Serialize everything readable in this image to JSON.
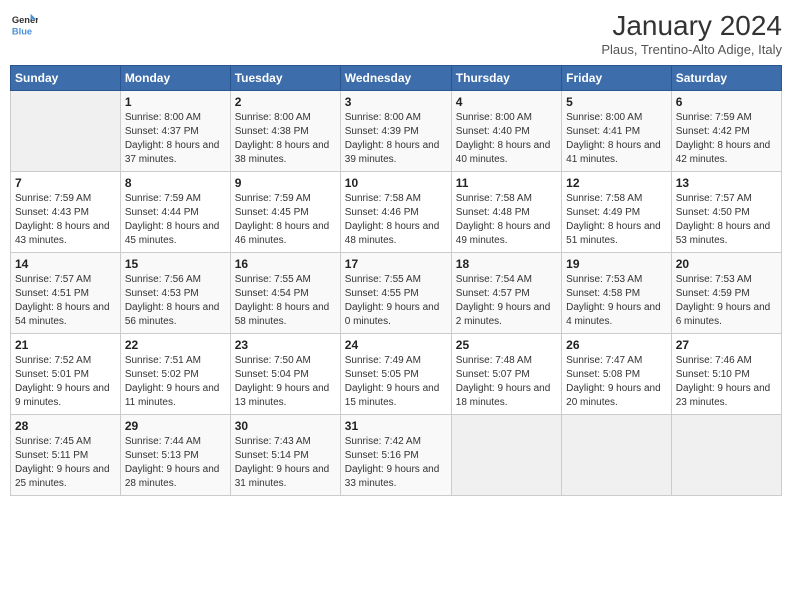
{
  "header": {
    "logo_text_general": "General",
    "logo_text_blue": "Blue",
    "title": "January 2024",
    "subtitle": "Plaus, Trentino-Alto Adige, Italy"
  },
  "weekdays": [
    "Sunday",
    "Monday",
    "Tuesday",
    "Wednesday",
    "Thursday",
    "Friday",
    "Saturday"
  ],
  "weeks": [
    [
      {
        "day": "",
        "sunrise": "",
        "sunset": "",
        "daylight": ""
      },
      {
        "day": "1",
        "sunrise": "Sunrise: 8:00 AM",
        "sunset": "Sunset: 4:37 PM",
        "daylight": "Daylight: 8 hours and 37 minutes."
      },
      {
        "day": "2",
        "sunrise": "Sunrise: 8:00 AM",
        "sunset": "Sunset: 4:38 PM",
        "daylight": "Daylight: 8 hours and 38 minutes."
      },
      {
        "day": "3",
        "sunrise": "Sunrise: 8:00 AM",
        "sunset": "Sunset: 4:39 PM",
        "daylight": "Daylight: 8 hours and 39 minutes."
      },
      {
        "day": "4",
        "sunrise": "Sunrise: 8:00 AM",
        "sunset": "Sunset: 4:40 PM",
        "daylight": "Daylight: 8 hours and 40 minutes."
      },
      {
        "day": "5",
        "sunrise": "Sunrise: 8:00 AM",
        "sunset": "Sunset: 4:41 PM",
        "daylight": "Daylight: 8 hours and 41 minutes."
      },
      {
        "day": "6",
        "sunrise": "Sunrise: 7:59 AM",
        "sunset": "Sunset: 4:42 PM",
        "daylight": "Daylight: 8 hours and 42 minutes."
      }
    ],
    [
      {
        "day": "7",
        "sunrise": "Sunrise: 7:59 AM",
        "sunset": "Sunset: 4:43 PM",
        "daylight": "Daylight: 8 hours and 43 minutes."
      },
      {
        "day": "8",
        "sunrise": "Sunrise: 7:59 AM",
        "sunset": "Sunset: 4:44 PM",
        "daylight": "Daylight: 8 hours and 45 minutes."
      },
      {
        "day": "9",
        "sunrise": "Sunrise: 7:59 AM",
        "sunset": "Sunset: 4:45 PM",
        "daylight": "Daylight: 8 hours and 46 minutes."
      },
      {
        "day": "10",
        "sunrise": "Sunrise: 7:58 AM",
        "sunset": "Sunset: 4:46 PM",
        "daylight": "Daylight: 8 hours and 48 minutes."
      },
      {
        "day": "11",
        "sunrise": "Sunrise: 7:58 AM",
        "sunset": "Sunset: 4:48 PM",
        "daylight": "Daylight: 8 hours and 49 minutes."
      },
      {
        "day": "12",
        "sunrise": "Sunrise: 7:58 AM",
        "sunset": "Sunset: 4:49 PM",
        "daylight": "Daylight: 8 hours and 51 minutes."
      },
      {
        "day": "13",
        "sunrise": "Sunrise: 7:57 AM",
        "sunset": "Sunset: 4:50 PM",
        "daylight": "Daylight: 8 hours and 53 minutes."
      }
    ],
    [
      {
        "day": "14",
        "sunrise": "Sunrise: 7:57 AM",
        "sunset": "Sunset: 4:51 PM",
        "daylight": "Daylight: 8 hours and 54 minutes."
      },
      {
        "day": "15",
        "sunrise": "Sunrise: 7:56 AM",
        "sunset": "Sunset: 4:53 PM",
        "daylight": "Daylight: 8 hours and 56 minutes."
      },
      {
        "day": "16",
        "sunrise": "Sunrise: 7:55 AM",
        "sunset": "Sunset: 4:54 PM",
        "daylight": "Daylight: 8 hours and 58 minutes."
      },
      {
        "day": "17",
        "sunrise": "Sunrise: 7:55 AM",
        "sunset": "Sunset: 4:55 PM",
        "daylight": "Daylight: 9 hours and 0 minutes."
      },
      {
        "day": "18",
        "sunrise": "Sunrise: 7:54 AM",
        "sunset": "Sunset: 4:57 PM",
        "daylight": "Daylight: 9 hours and 2 minutes."
      },
      {
        "day": "19",
        "sunrise": "Sunrise: 7:53 AM",
        "sunset": "Sunset: 4:58 PM",
        "daylight": "Daylight: 9 hours and 4 minutes."
      },
      {
        "day": "20",
        "sunrise": "Sunrise: 7:53 AM",
        "sunset": "Sunset: 4:59 PM",
        "daylight": "Daylight: 9 hours and 6 minutes."
      }
    ],
    [
      {
        "day": "21",
        "sunrise": "Sunrise: 7:52 AM",
        "sunset": "Sunset: 5:01 PM",
        "daylight": "Daylight: 9 hours and 9 minutes."
      },
      {
        "day": "22",
        "sunrise": "Sunrise: 7:51 AM",
        "sunset": "Sunset: 5:02 PM",
        "daylight": "Daylight: 9 hours and 11 minutes."
      },
      {
        "day": "23",
        "sunrise": "Sunrise: 7:50 AM",
        "sunset": "Sunset: 5:04 PM",
        "daylight": "Daylight: 9 hours and 13 minutes."
      },
      {
        "day": "24",
        "sunrise": "Sunrise: 7:49 AM",
        "sunset": "Sunset: 5:05 PM",
        "daylight": "Daylight: 9 hours and 15 minutes."
      },
      {
        "day": "25",
        "sunrise": "Sunrise: 7:48 AM",
        "sunset": "Sunset: 5:07 PM",
        "daylight": "Daylight: 9 hours and 18 minutes."
      },
      {
        "day": "26",
        "sunrise": "Sunrise: 7:47 AM",
        "sunset": "Sunset: 5:08 PM",
        "daylight": "Daylight: 9 hours and 20 minutes."
      },
      {
        "day": "27",
        "sunrise": "Sunrise: 7:46 AM",
        "sunset": "Sunset: 5:10 PM",
        "daylight": "Daylight: 9 hours and 23 minutes."
      }
    ],
    [
      {
        "day": "28",
        "sunrise": "Sunrise: 7:45 AM",
        "sunset": "Sunset: 5:11 PM",
        "daylight": "Daylight: 9 hours and 25 minutes."
      },
      {
        "day": "29",
        "sunrise": "Sunrise: 7:44 AM",
        "sunset": "Sunset: 5:13 PM",
        "daylight": "Daylight: 9 hours and 28 minutes."
      },
      {
        "day": "30",
        "sunrise": "Sunrise: 7:43 AM",
        "sunset": "Sunset: 5:14 PM",
        "daylight": "Daylight: 9 hours and 31 minutes."
      },
      {
        "day": "31",
        "sunrise": "Sunrise: 7:42 AM",
        "sunset": "Sunset: 5:16 PM",
        "daylight": "Daylight: 9 hours and 33 minutes."
      },
      {
        "day": "",
        "sunrise": "",
        "sunset": "",
        "daylight": ""
      },
      {
        "day": "",
        "sunrise": "",
        "sunset": "",
        "daylight": ""
      },
      {
        "day": "",
        "sunrise": "",
        "sunset": "",
        "daylight": ""
      }
    ]
  ]
}
